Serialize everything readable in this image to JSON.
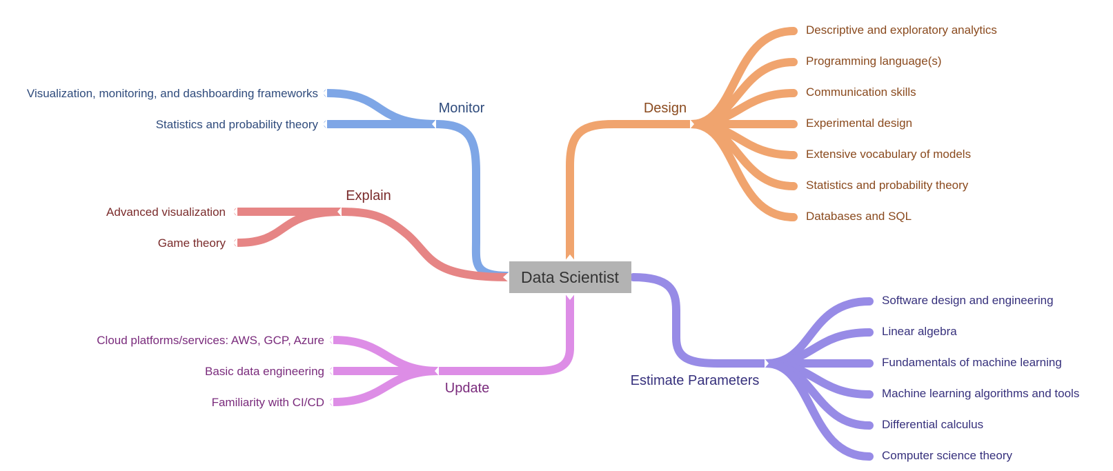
{
  "center": {
    "label": "Data Scientist"
  },
  "branches": {
    "monitor": {
      "label": "Monitor",
      "color": "#7ea6e6",
      "text_color": "#2f4b7c",
      "items": [
        "Visualization, monitoring, and dashboarding frameworks",
        "Statistics and probability theory"
      ]
    },
    "explain": {
      "label": "Explain",
      "color": "#e68585",
      "text_color": "#7a2b2b",
      "items": [
        "Advanced visualization",
        "Game theory"
      ]
    },
    "update": {
      "label": "Update",
      "color": "#dd8de6",
      "text_color": "#7a2b7c",
      "items": [
        "Cloud platforms/services: AWS, GCP, Azure",
        "Basic data engineering",
        "Familiarity with CI/CD"
      ]
    },
    "design": {
      "label": "Design",
      "color": "#f0a46e",
      "text_color": "#8a4a1e",
      "items": [
        "Descriptive and exploratory analytics",
        "Programming language(s)",
        "Communication skills",
        "Experimental design",
        "Extensive vocabulary of models",
        "Statistics and probability theory",
        "Databases and SQL"
      ]
    },
    "estimate": {
      "label": "Estimate Parameters",
      "color": "#978be6",
      "text_color": "#36307c",
      "items": [
        "Software design and engineering",
        "Linear algebra",
        "Fundamentals of machine learning",
        "Machine learning algorithms and tools",
        "Differential calculus",
        "Computer science theory"
      ]
    }
  }
}
